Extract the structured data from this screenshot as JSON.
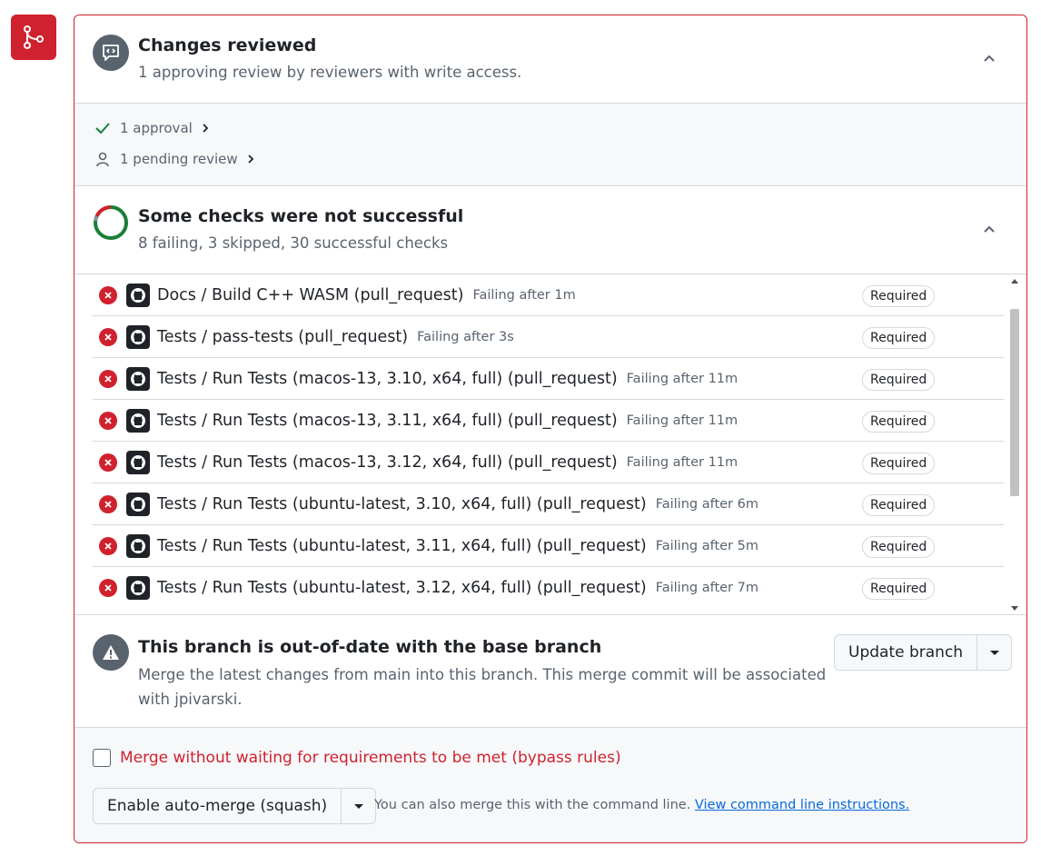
{
  "reviews": {
    "title": "Changes reviewed",
    "subtitle": "1 approving review by reviewers with write access.",
    "approvals": "1 approval",
    "pending": "1 pending review"
  },
  "checks": {
    "title": "Some checks were not successful",
    "subtitle": "8 failing, 3 skipped, 30 successful checks",
    "items": [
      {
        "name": "Docs / Build C++ WASM (pull_request)",
        "status": "Failing after 1m",
        "badge": "Required"
      },
      {
        "name": "Tests / pass-tests (pull_request)",
        "status": "Failing after 3s",
        "badge": "Required"
      },
      {
        "name": "Tests / Run Tests (macos-13, 3.10, x64, full) (pull_request)",
        "status": "Failing after 11m",
        "badge": "Required"
      },
      {
        "name": "Tests / Run Tests (macos-13, 3.11, x64, full) (pull_request)",
        "status": "Failing after 11m",
        "badge": "Required"
      },
      {
        "name": "Tests / Run Tests (macos-13, 3.12, x64, full) (pull_request)",
        "status": "Failing after 11m",
        "badge": "Required"
      },
      {
        "name": "Tests / Run Tests (ubuntu-latest, 3.10, x64, full) (pull_request)",
        "status": "Failing after 6m",
        "badge": "Required"
      },
      {
        "name": "Tests / Run Tests (ubuntu-latest, 3.11, x64, full) (pull_request)",
        "status": "Failing after 5m",
        "badge": "Required"
      },
      {
        "name": "Tests / Run Tests (ubuntu-latest, 3.12, x64, full) (pull_request)",
        "status": "Failing after 7m",
        "badge": "Required"
      }
    ]
  },
  "branch": {
    "title": "This branch is out-of-date with the base branch",
    "description": "Merge the latest changes from main into this branch. This merge commit will be associated with jpivarski.",
    "update_label": "Update branch"
  },
  "merge": {
    "bypass_label": "Merge without waiting for requirements to be met (bypass rules)",
    "bypass_checked": false,
    "automerge_label": "Enable auto-merge (squash)",
    "cli_text": "You can also merge this with the command line.",
    "cli_link": "View command line instructions."
  },
  "icons": {
    "merge": "git-merge-icon",
    "comment": "comment-code-icon",
    "check": "check-icon",
    "person": "person-icon",
    "fail": "x-circle-icon",
    "github": "github-mark-icon",
    "alert": "alert-icon"
  },
  "colors": {
    "danger": "#cf222e",
    "success": "#1a7f37",
    "muted": "#59636e",
    "link": "#0969da"
  }
}
